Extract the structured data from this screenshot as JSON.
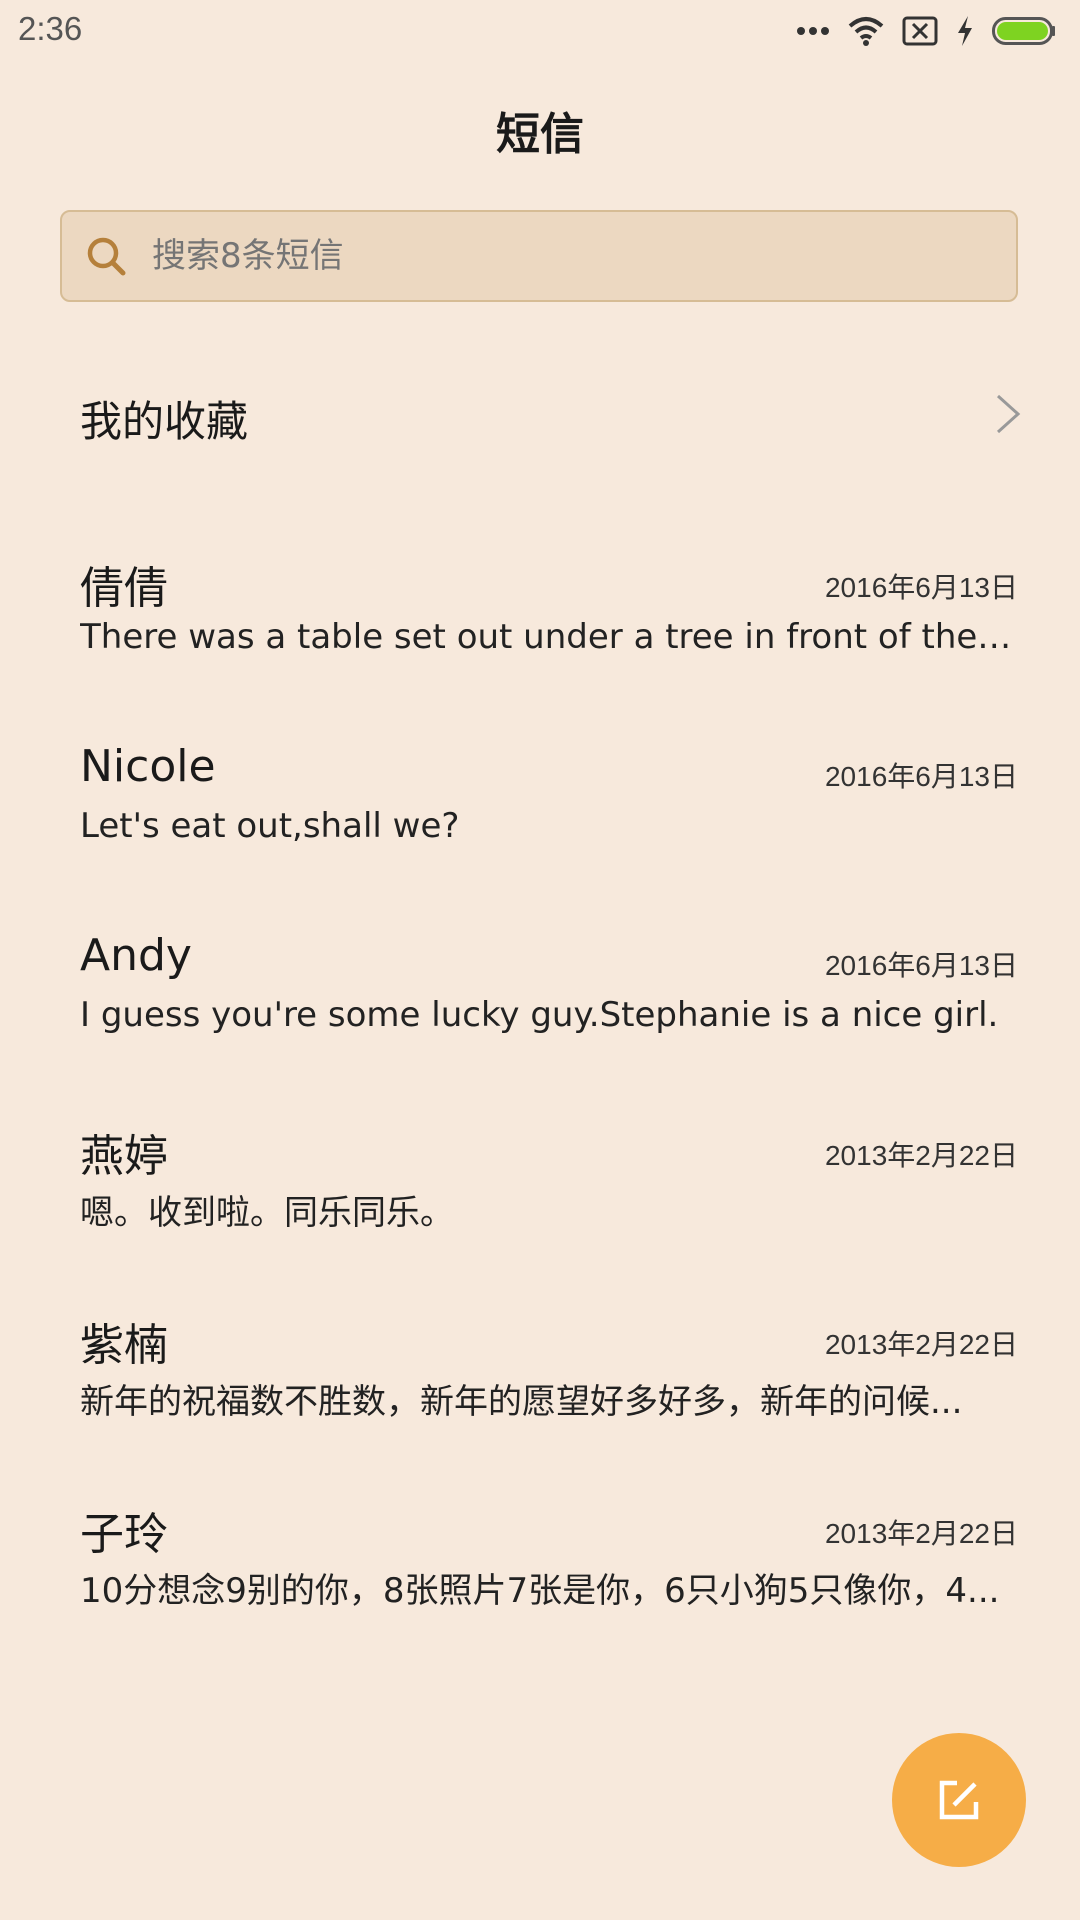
{
  "status_bar": {
    "time": "2:36",
    "icons": [
      "more-dots-icon",
      "wifi-icon",
      "no-sim-icon",
      "charging-bolt-icon",
      "battery-icon"
    ],
    "battery_color": "#7ed321"
  },
  "header": {
    "title": "短信"
  },
  "search": {
    "placeholder": "搜索8条短信"
  },
  "favorites": {
    "label": "我的收藏"
  },
  "conversations": [
    {
      "name": "倩倩",
      "date": "2016年6月13日",
      "snippet": "There was a table set out under a tree in front of the ho..."
    },
    {
      "name": "Nicole",
      "date": "2016年6月13日",
      "snippet": "Let's eat out,shall we?"
    },
    {
      "name": "Andy",
      "date": "2016年6月13日",
      "snippet": "I guess you're some lucky guy.Stephanie is a nice girl."
    },
    {
      "name": "燕婷",
      "date": "2013年2月22日",
      "snippet": "嗯。收到啦。同乐同乐。"
    },
    {
      "name": "紫楠",
      "date": "2013年2月22日",
      "snippet": "新年的祝福数不胜数，新年的愿望好多好多，新年的问候..."
    },
    {
      "name": "子玲",
      "date": "2013年2月22日",
      "snippet": "10分想念9别的你，8张照片7张是你，6只小狗5只像你，4..."
    }
  ],
  "compose": {
    "icon": "compose-icon",
    "color": "#f6ad47"
  }
}
